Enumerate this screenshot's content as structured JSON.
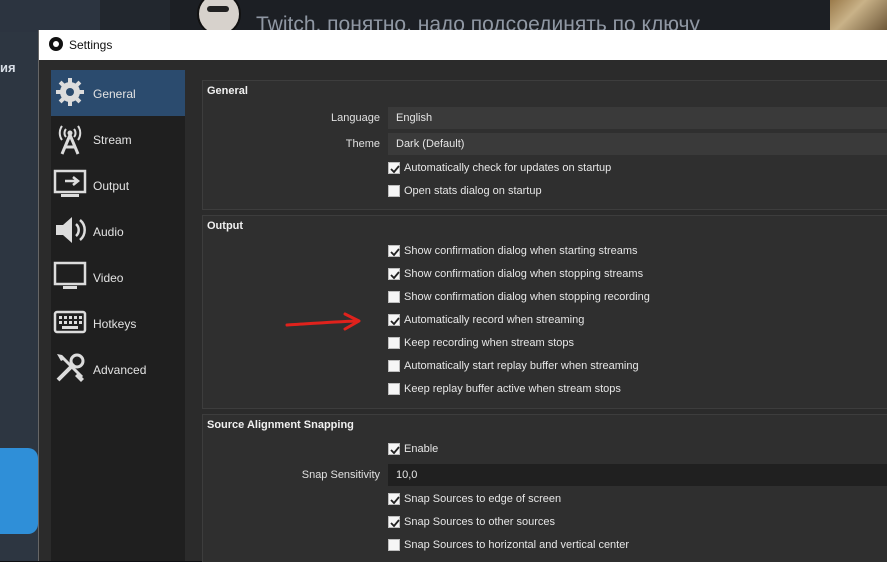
{
  "background": {
    "headline": "Twitch, понятно, надо подсоединять по ключу",
    "left_word": "ия"
  },
  "window": {
    "title": "Settings"
  },
  "sidebar": {
    "items": [
      {
        "label": "General",
        "icon": "gear-icon",
        "active": true
      },
      {
        "label": "Stream",
        "icon": "broadcast-tower-icon"
      },
      {
        "label": "Output",
        "icon": "monitor-output-icon"
      },
      {
        "label": "Audio",
        "icon": "speaker-icon"
      },
      {
        "label": "Video",
        "icon": "display-icon"
      },
      {
        "label": "Hotkeys",
        "icon": "keyboard-icon"
      },
      {
        "label": "Advanced",
        "icon": "wrench-screwdriver-icon"
      }
    ]
  },
  "general": {
    "title": "General",
    "language_label": "Language",
    "language_value": "English",
    "theme_label": "Theme",
    "theme_value": "Dark (Default)",
    "checks": [
      {
        "label": "Automatically check for updates on startup",
        "checked": true
      },
      {
        "label": "Open stats dialog on startup",
        "checked": false
      }
    ]
  },
  "output": {
    "title": "Output",
    "checks": [
      {
        "label": "Show confirmation dialog when starting streams",
        "checked": true
      },
      {
        "label": "Show confirmation dialog when stopping streams",
        "checked": true
      },
      {
        "label": "Show confirmation dialog when stopping recording",
        "checked": false
      },
      {
        "label": "Automatically record when streaming",
        "checked": true
      },
      {
        "label": "Keep recording when stream stops",
        "checked": false
      },
      {
        "label": "Automatically start replay buffer when streaming",
        "checked": false
      },
      {
        "label": "Keep replay buffer active when stream stops",
        "checked": false
      }
    ]
  },
  "snapping": {
    "title": "Source Alignment Snapping",
    "enable": {
      "label": "Enable",
      "checked": true
    },
    "sensitivity_label": "Snap Sensitivity",
    "sensitivity_value": "10,0",
    "checks": [
      {
        "label": "Snap Sources to edge of screen",
        "checked": true
      },
      {
        "label": "Snap Sources to other sources",
        "checked": true
      },
      {
        "label": "Snap Sources to horizontal and vertical center",
        "checked": false
      }
    ]
  },
  "colors": {
    "accent": "#2b4b6e",
    "annotation_arrow": "#e0221c"
  }
}
